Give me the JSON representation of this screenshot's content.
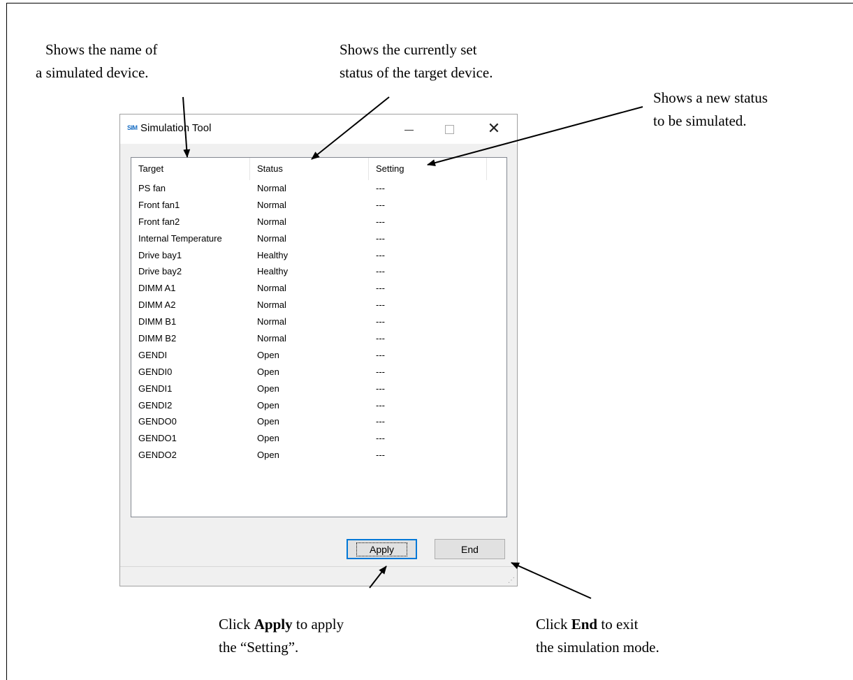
{
  "callouts": {
    "target_name": [
      "Shows the name of",
      "a simulated device."
    ],
    "status": [
      "Shows the currently set",
      "status of the target device."
    ],
    "setting": [
      "Shows a new status",
      "to be simulated."
    ],
    "apply": {
      "pre": "Click ",
      "bold": "Apply",
      "post": " to apply",
      "line2": "the “Setting”."
    },
    "end": {
      "pre": "Click ",
      "bold": "End",
      "post": " to exit",
      "line2": "the simulation mode."
    }
  },
  "window": {
    "icon": "SIM",
    "title": "Simulation Tool",
    "minimize_icon": "minimize-icon",
    "maximize_icon": "maximize-icon",
    "close_glyph": "✕"
  },
  "table": {
    "headers": [
      "Target",
      "Status",
      "Setting"
    ],
    "rows": [
      {
        "target": "PS fan",
        "status": "Normal",
        "setting": "---"
      },
      {
        "target": "Front fan1",
        "status": "Normal",
        "setting": "---"
      },
      {
        "target": "Front fan2",
        "status": "Normal",
        "setting": "---"
      },
      {
        "target": "Internal Temperature",
        "status": "Normal",
        "setting": "---"
      },
      {
        "target": "Drive bay1",
        "status": "Healthy",
        "setting": "---"
      },
      {
        "target": "Drive bay2",
        "status": "Healthy",
        "setting": "---"
      },
      {
        "target": "DIMM A1",
        "status": "Normal",
        "setting": "---"
      },
      {
        "target": "DIMM A2",
        "status": "Normal",
        "setting": "---"
      },
      {
        "target": "DIMM B1",
        "status": "Normal",
        "setting": "---"
      },
      {
        "target": "DIMM B2",
        "status": "Normal",
        "setting": "---"
      },
      {
        "target": "GENDI",
        "status": "Open",
        "setting": "---"
      },
      {
        "target": "GENDI0",
        "status": "Open",
        "setting": "---"
      },
      {
        "target": "GENDI1",
        "status": "Open",
        "setting": "---"
      },
      {
        "target": "GENDI2",
        "status": "Open",
        "setting": "---"
      },
      {
        "target": "GENDO0",
        "status": "Open",
        "setting": "---"
      },
      {
        "target": "GENDO1",
        "status": "Open",
        "setting": "---"
      },
      {
        "target": "GENDO2",
        "status": "Open",
        "setting": "---"
      }
    ]
  },
  "buttons": {
    "apply": "Apply",
    "end": "End"
  }
}
